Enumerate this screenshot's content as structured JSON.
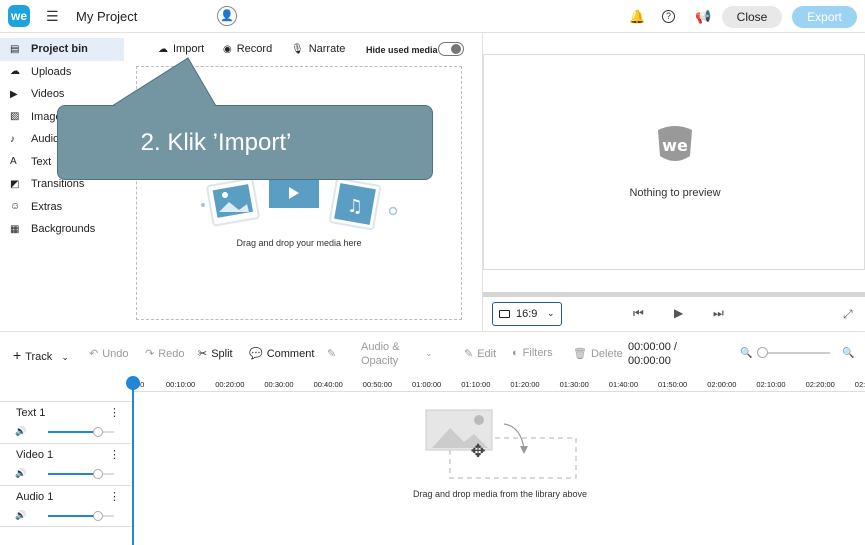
{
  "header": {
    "logo_text": "we",
    "project_title": "My Project",
    "close_label": "Close",
    "export_label": "Export"
  },
  "sidebar": {
    "items": [
      {
        "label": "Project bin",
        "icon": "project-bin-icon",
        "active": true
      },
      {
        "label": "Uploads",
        "icon": "upload-cloud-icon"
      },
      {
        "label": "Videos",
        "icon": "video-icon"
      },
      {
        "label": "Images",
        "icon": "image-icon"
      },
      {
        "label": "Audio",
        "icon": "music-note-icon"
      },
      {
        "label": "Text",
        "icon": "text-icon"
      },
      {
        "label": "Transitions",
        "icon": "transitions-icon"
      },
      {
        "label": "Extras",
        "icon": "smiley-icon"
      },
      {
        "label": "Backgrounds",
        "icon": "backgrounds-icon"
      }
    ]
  },
  "bin": {
    "import_label": "Import",
    "record_label": "Record",
    "narrate_label": "Narrate",
    "hide_used_label": "Hide used media",
    "drop_text": "Drag and drop your media here"
  },
  "preview": {
    "empty_text": "Nothing to preview",
    "aspect_ratio": "16:9"
  },
  "timeline": {
    "track_label": "Track",
    "undo_label": "Undo",
    "redo_label": "Redo",
    "split_label": "Split",
    "comment_label": "Comment",
    "audio_opacity_label_1": "Audio &",
    "audio_opacity_label_2": "Opacity",
    "edit_label": "Edit",
    "filters_label": "Filters",
    "delete_label": "Delete",
    "timecode_current": "00:00:00 /",
    "timecode_total": "00:00:00",
    "ruler": [
      "00",
      "00:10:00",
      "00:20:00",
      "00:30:00",
      "00:40:00",
      "00:50:00",
      "01:00:00",
      "01:10:00",
      "01:20:00",
      "01:30:00",
      "01:40:00",
      "01:50:00",
      "02:00:00",
      "02:10:00",
      "02:20:00",
      "02:3"
    ],
    "tracks": [
      {
        "name": "Text 1",
        "volume": 0.75
      },
      {
        "name": "Video 1",
        "volume": 0.75
      },
      {
        "name": "Audio 1",
        "volume": 0.75
      }
    ],
    "drop_text": "Drag and drop media from the library above"
  },
  "callout": {
    "text": "2. Klik ’Import’"
  },
  "colors": {
    "brand": "#1fa3dd",
    "playhead": "#1f87d6",
    "callout": "#7496a3"
  }
}
